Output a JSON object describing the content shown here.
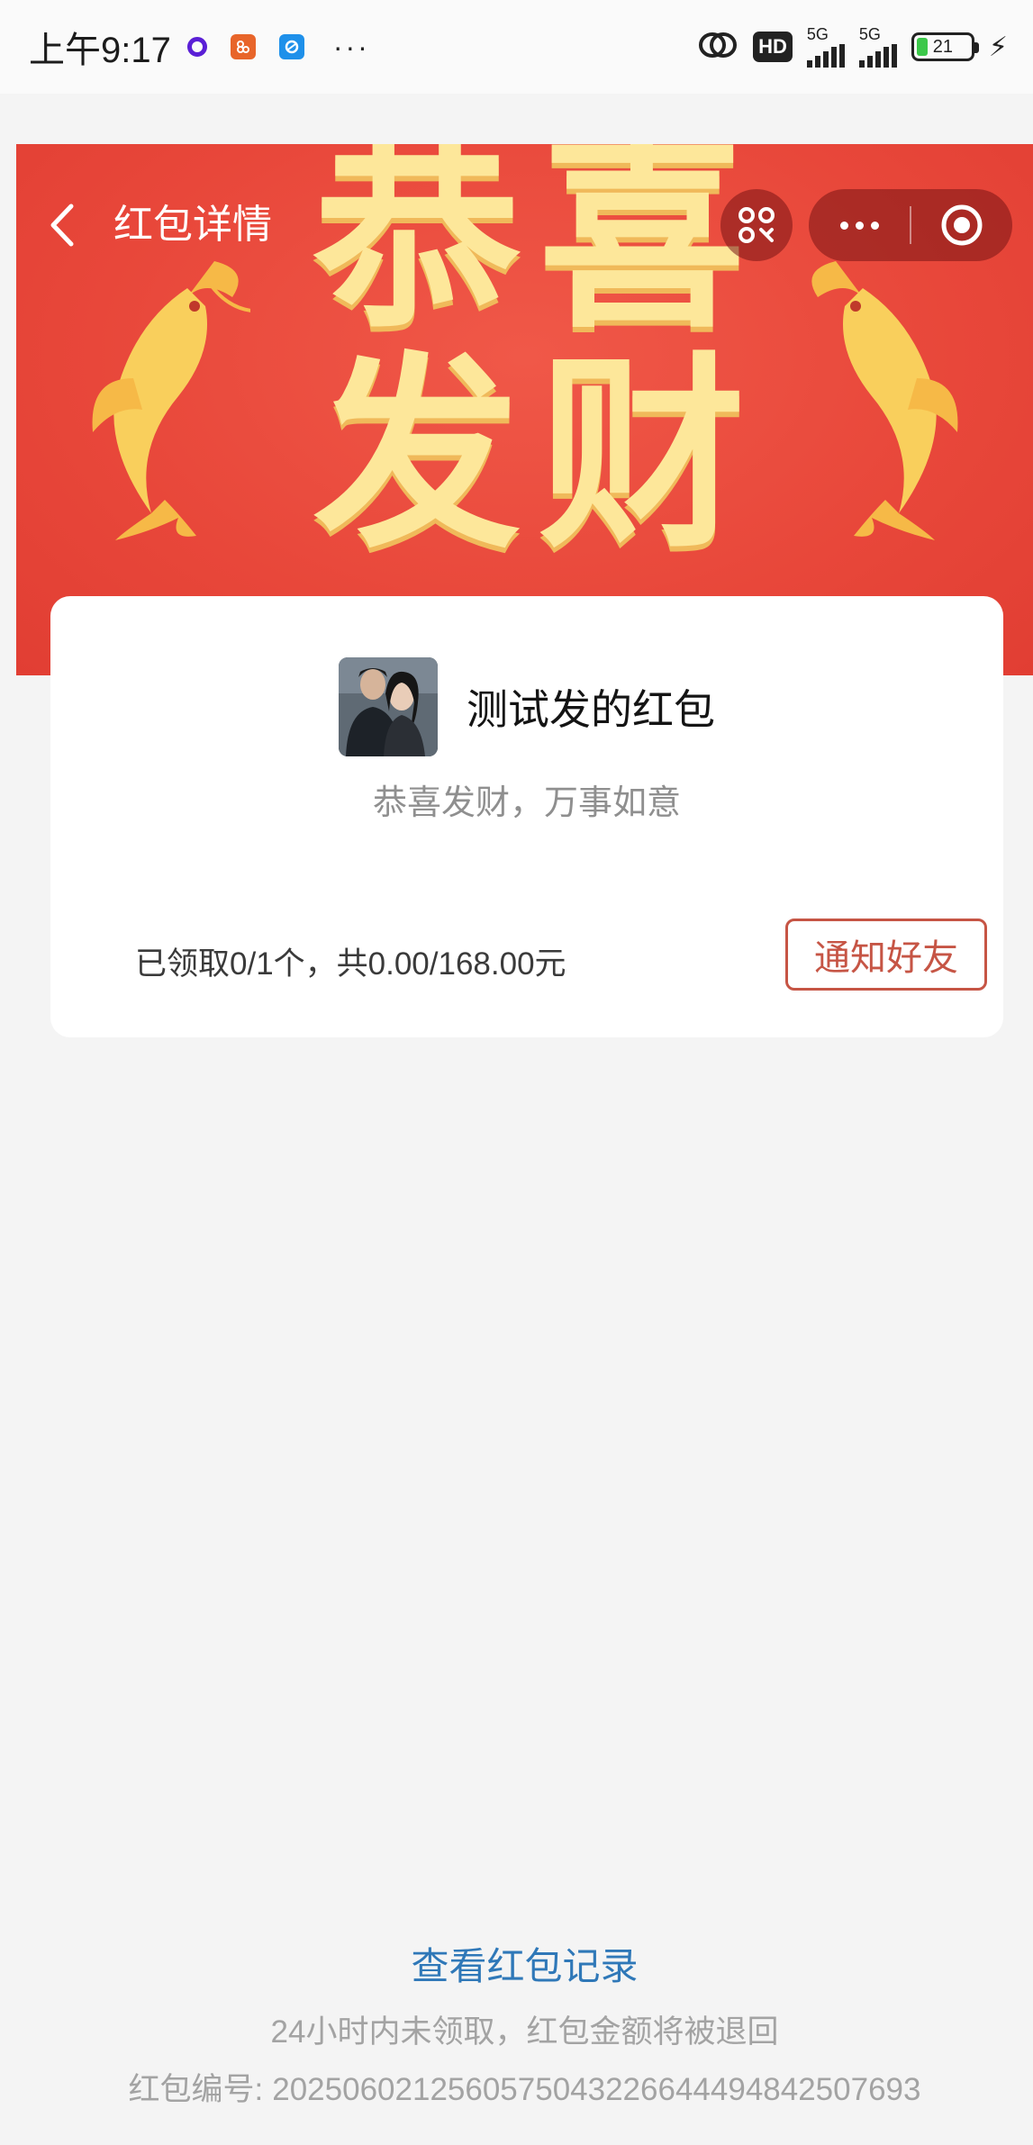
{
  "status_bar": {
    "time": "上午9:17",
    "hd_label": "HD",
    "sig1_label": "5G",
    "sig2_label": "5G",
    "battery": "21",
    "more": "···"
  },
  "nav": {
    "title": "红包详情"
  },
  "banner": {
    "chars": [
      "恭",
      "喜",
      "发",
      "财"
    ]
  },
  "card": {
    "sender_name": "测试发的红包",
    "greeting": "恭喜发财，万事如意",
    "summary": "已领取0/1个，共0.00/168.00元",
    "notify_button": "通知好友"
  },
  "footer": {
    "view_record": "查看红包记录",
    "refund_note": "24小时内未领取，红包金额将被退回",
    "packet_id_label": "红包编号:",
    "packet_id_value": "2025060212560575043226644494842507693"
  }
}
